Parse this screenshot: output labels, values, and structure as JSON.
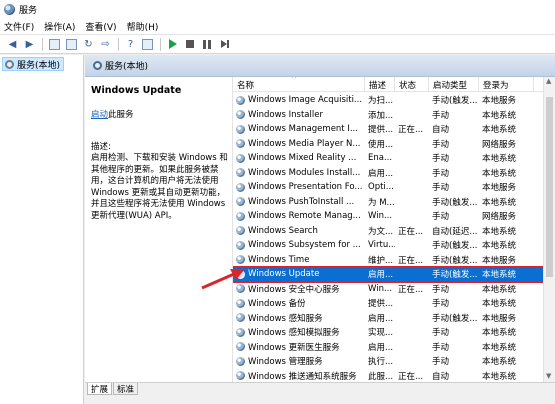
{
  "window": {
    "title": "服务"
  },
  "menu": [
    "文件(F)",
    "操作(A)",
    "查看(V)",
    "帮助(H)"
  ],
  "tree": {
    "root": "服务(本地)"
  },
  "pane_header": "服务(本地)",
  "description": {
    "service_name": "Windows Update",
    "start_link": "启动",
    "start_suffix": "此服务",
    "label": "描述:",
    "text": "启用检测、下载和安装 Windows 和其他程序的更新。如果此服务被禁用，这台计算机的用户将无法使用 Windows 更新或其自动更新功能，并且这些程序将无法使用 Windows 更新代理(WUA) API。"
  },
  "columns": {
    "name": "名称",
    "desc": "描述",
    "status": "状态",
    "startup": "启动类型",
    "logon": "登录为",
    "sort_arrow": "^"
  },
  "services": [
    {
      "name": "Windows Image Acquisiti...",
      "desc": "为扫...",
      "status": "",
      "startup": "手动(触发...",
      "logon": "本地服务"
    },
    {
      "name": "Windows Installer",
      "desc": "添加...",
      "status": "",
      "startup": "手动",
      "logon": "本地系统"
    },
    {
      "name": "Windows Management I...",
      "desc": "提供...",
      "status": "正在...",
      "startup": "自动",
      "logon": "本地系统"
    },
    {
      "name": "Windows Media Player N...",
      "desc": "使用...",
      "status": "",
      "startup": "手动",
      "logon": "网络服务"
    },
    {
      "name": "Windows Mixed Reality ...",
      "desc": "Ena...",
      "status": "",
      "startup": "手动",
      "logon": "本地系统"
    },
    {
      "name": "Windows Modules Install...",
      "desc": "启用...",
      "status": "",
      "startup": "手动",
      "logon": "本地系统"
    },
    {
      "name": "Windows Presentation Fo...",
      "desc": "Opti...",
      "status": "",
      "startup": "手动",
      "logon": "本地服务"
    },
    {
      "name": "Windows PushToInstall ...",
      "desc": "为 M...",
      "status": "",
      "startup": "手动(触发...",
      "logon": "本地系统"
    },
    {
      "name": "Windows Remote Manag...",
      "desc": "Win...",
      "status": "",
      "startup": "手动",
      "logon": "网络服务"
    },
    {
      "name": "Windows Search",
      "desc": "为文...",
      "status": "正在...",
      "startup": "自动(延迟...",
      "logon": "本地系统"
    },
    {
      "name": "Windows Subsystem for ...",
      "desc": "Virtu...",
      "status": "",
      "startup": "手动(触发...",
      "logon": "本地系统"
    },
    {
      "name": "Windows Time",
      "desc": "维护...",
      "status": "正在...",
      "startup": "手动(触发...",
      "logon": "本地服务"
    },
    {
      "name": "Windows Update",
      "desc": "启用...",
      "status": "",
      "startup": "手动(触发...",
      "logon": "本地系统",
      "selected": true
    },
    {
      "name": "Windows 安全中心服务",
      "desc": "Win...",
      "status": "正在...",
      "startup": "手动",
      "logon": "本地系统"
    },
    {
      "name": "Windows 备份",
      "desc": "提供...",
      "status": "",
      "startup": "手动",
      "logon": "本地系统"
    },
    {
      "name": "Windows 感知服务",
      "desc": "启用...",
      "status": "",
      "startup": "手动(触发...",
      "logon": "本地服务"
    },
    {
      "name": "Windows 感知模拟服务",
      "desc": "实现...",
      "status": "",
      "startup": "手动",
      "logon": "本地系统"
    },
    {
      "name": "Windows 更新医生服务",
      "desc": "启用...",
      "status": "",
      "startup": "手动",
      "logon": "本地系统"
    },
    {
      "name": "Windows 管理服务",
      "desc": "执行...",
      "status": "",
      "startup": "手动",
      "logon": "本地系统"
    },
    {
      "name": "Windows 推送通知系统服务",
      "desc": "此服...",
      "status": "正在...",
      "startup": "自动",
      "logon": "本地系统"
    }
  ],
  "tabs": [
    "扩展",
    "标准"
  ],
  "colors": {
    "selection": "#0a6fd1",
    "highlight_border": "#e0202a",
    "arrow": "#d8262c"
  }
}
